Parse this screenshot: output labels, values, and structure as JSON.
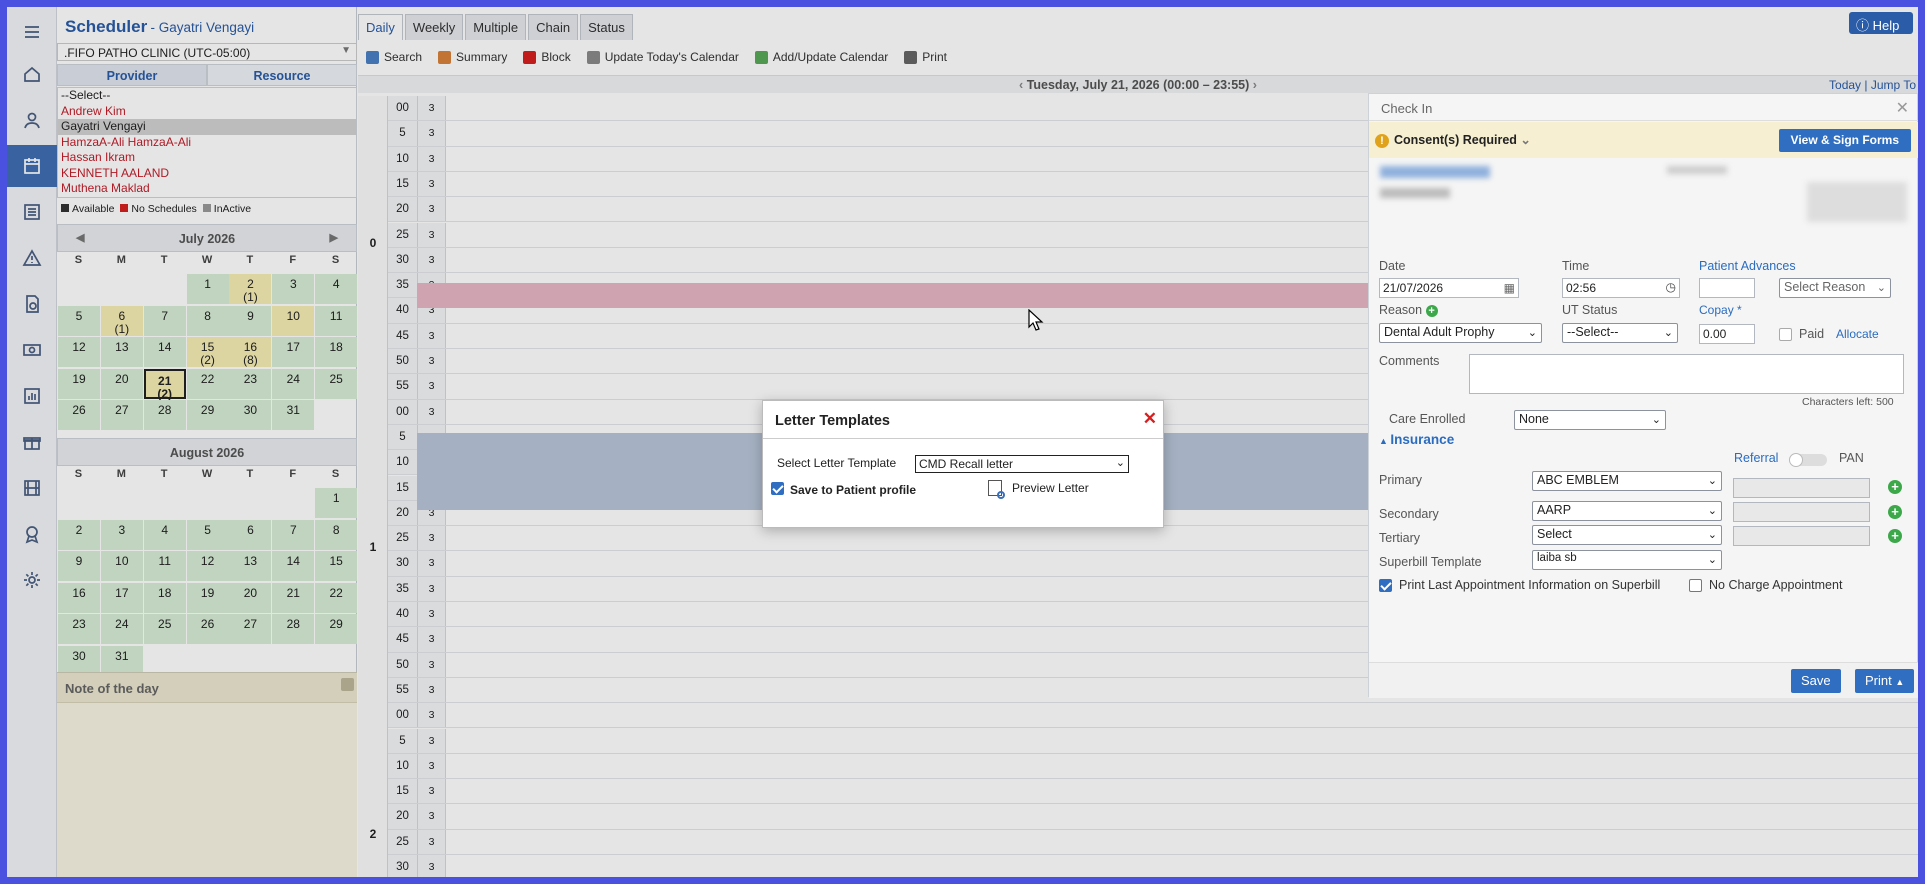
{
  "app": {
    "title": "Scheduler",
    "user": "- Gayatri Vengayi",
    "help": "Help"
  },
  "clinic": ".FIFO PATHO CLINIC (UTC-05:00)",
  "left_tabs": [
    "Provider",
    "Resource"
  ],
  "providers": [
    {
      "name": "--Select--",
      "style": "plain"
    },
    {
      "name": "Andrew Kim",
      "style": "red"
    },
    {
      "name": "Gayatri Vengayi",
      "style": "sel"
    },
    {
      "name": "HamzaA-Ali HamzaA-Ali",
      "style": "red"
    },
    {
      "name": "Hassan Ikram",
      "style": "red"
    },
    {
      "name": "KENNETH AALAND",
      "style": "red"
    },
    {
      "name": "Muthena Maklad",
      "style": "red"
    }
  ],
  "legend": [
    {
      "label": "Available",
      "color": "#333333"
    },
    {
      "label": "No Schedules",
      "color": "#d62020"
    },
    {
      "label": "InActive",
      "color": "#999999"
    }
  ],
  "weekdays": [
    "S",
    "M",
    "T",
    "W",
    "T",
    "F",
    "S"
  ],
  "july": {
    "title": "July 2026",
    "days": [
      {
        "d": "1",
        "s": "",
        "c": "g",
        "col": 3,
        "row": 0
      },
      {
        "d": "2",
        "s": "(1)",
        "c": "y",
        "col": 4,
        "row": 0
      },
      {
        "d": "3",
        "s": "",
        "c": "g",
        "col": 5,
        "row": 0
      },
      {
        "d": "4",
        "s": "",
        "c": "g",
        "col": 6,
        "row": 0
      },
      {
        "d": "5",
        "s": "",
        "c": "g",
        "col": 0,
        "row": 1
      },
      {
        "d": "6",
        "s": "(1)",
        "c": "y",
        "col": 1,
        "row": 1
      },
      {
        "d": "7",
        "s": "",
        "c": "g",
        "col": 2,
        "row": 1
      },
      {
        "d": "8",
        "s": "",
        "c": "g",
        "col": 3,
        "row": 1
      },
      {
        "d": "9",
        "s": "",
        "c": "g",
        "col": 4,
        "row": 1
      },
      {
        "d": "10",
        "s": "",
        "c": "y",
        "col": 5,
        "row": 1
      },
      {
        "d": "11",
        "s": "",
        "c": "g",
        "col": 6,
        "row": 1
      },
      {
        "d": "12",
        "s": "",
        "c": "g",
        "col": 0,
        "row": 2
      },
      {
        "d": "13",
        "s": "",
        "c": "g",
        "col": 1,
        "row": 2
      },
      {
        "d": "14",
        "s": "",
        "c": "g",
        "col": 2,
        "row": 2
      },
      {
        "d": "15",
        "s": "(2)",
        "c": "y",
        "col": 3,
        "row": 2
      },
      {
        "d": "16",
        "s": "(8)",
        "c": "y",
        "col": 4,
        "row": 2
      },
      {
        "d": "17",
        "s": "",
        "c": "g",
        "col": 5,
        "row": 2
      },
      {
        "d": "18",
        "s": "",
        "c": "g",
        "col": 6,
        "row": 2
      },
      {
        "d": "19",
        "s": "",
        "c": "g",
        "col": 0,
        "row": 3
      },
      {
        "d": "20",
        "s": "",
        "c": "g",
        "col": 1,
        "row": 3
      },
      {
        "d": "21",
        "s": "(2)",
        "c": "today",
        "col": 2,
        "row": 3
      },
      {
        "d": "22",
        "s": "",
        "c": "g",
        "col": 3,
        "row": 3
      },
      {
        "d": "23",
        "s": "",
        "c": "g",
        "col": 4,
        "row": 3
      },
      {
        "d": "24",
        "s": "",
        "c": "g",
        "col": 5,
        "row": 3
      },
      {
        "d": "25",
        "s": "",
        "c": "g",
        "col": 6,
        "row": 3
      },
      {
        "d": "26",
        "s": "",
        "c": "g",
        "col": 0,
        "row": 4
      },
      {
        "d": "27",
        "s": "",
        "c": "g",
        "col": 1,
        "row": 4
      },
      {
        "d": "28",
        "s": "",
        "c": "g",
        "col": 2,
        "row": 4
      },
      {
        "d": "29",
        "s": "",
        "c": "g",
        "col": 3,
        "row": 4
      },
      {
        "d": "30",
        "s": "",
        "c": "g",
        "col": 4,
        "row": 4
      },
      {
        "d": "31",
        "s": "",
        "c": "g",
        "col": 5,
        "row": 4
      }
    ]
  },
  "august": {
    "title": "August 2026",
    "days": [
      {
        "d": "1",
        "s": "",
        "c": "g",
        "col": 6,
        "row": 0
      },
      {
        "d": "2",
        "s": "",
        "c": "g",
        "col": 0,
        "row": 1
      },
      {
        "d": "3",
        "s": "",
        "c": "g",
        "col": 1,
        "row": 1
      },
      {
        "d": "4",
        "s": "",
        "c": "g",
        "col": 2,
        "row": 1
      },
      {
        "d": "5",
        "s": "",
        "c": "g",
        "col": 3,
        "row": 1
      },
      {
        "d": "6",
        "s": "",
        "c": "g",
        "col": 4,
        "row": 1
      },
      {
        "d": "7",
        "s": "",
        "c": "g",
        "col": 5,
        "row": 1
      },
      {
        "d": "8",
        "s": "",
        "c": "g",
        "col": 6,
        "row": 1
      },
      {
        "d": "9",
        "s": "",
        "c": "g",
        "col": 0,
        "row": 2
      },
      {
        "d": "10",
        "s": "",
        "c": "g",
        "col": 1,
        "row": 2
      },
      {
        "d": "11",
        "s": "",
        "c": "g",
        "col": 2,
        "row": 2
      },
      {
        "d": "12",
        "s": "",
        "c": "g",
        "col": 3,
        "row": 2
      },
      {
        "d": "13",
        "s": "",
        "c": "g",
        "col": 4,
        "row": 2
      },
      {
        "d": "14",
        "s": "",
        "c": "g",
        "col": 5,
        "row": 2
      },
      {
        "d": "15",
        "s": "",
        "c": "g",
        "col": 6,
        "row": 2
      },
      {
        "d": "16",
        "s": "",
        "c": "g",
        "col": 0,
        "row": 3
      },
      {
        "d": "17",
        "s": "",
        "c": "g",
        "col": 1,
        "row": 3
      },
      {
        "d": "18",
        "s": "",
        "c": "g",
        "col": 2,
        "row": 3
      },
      {
        "d": "19",
        "s": "",
        "c": "g",
        "col": 3,
        "row": 3
      },
      {
        "d": "20",
        "s": "",
        "c": "g",
        "col": 4,
        "row": 3
      },
      {
        "d": "21",
        "s": "",
        "c": "g",
        "col": 5,
        "row": 3
      },
      {
        "d": "22",
        "s": "",
        "c": "g",
        "col": 6,
        "row": 3
      },
      {
        "d": "23",
        "s": "",
        "c": "g",
        "col": 0,
        "row": 4
      },
      {
        "d": "24",
        "s": "",
        "c": "g",
        "col": 1,
        "row": 4
      },
      {
        "d": "25",
        "s": "",
        "c": "g",
        "col": 2,
        "row": 4
      },
      {
        "d": "26",
        "s": "",
        "c": "g",
        "col": 3,
        "row": 4
      },
      {
        "d": "27",
        "s": "",
        "c": "g",
        "col": 4,
        "row": 4
      },
      {
        "d": "28",
        "s": "",
        "c": "g",
        "col": 5,
        "row": 4
      },
      {
        "d": "29",
        "s": "",
        "c": "g",
        "col": 6,
        "row": 4
      },
      {
        "d": "30",
        "s": "",
        "c": "g",
        "col": 0,
        "row": 5
      },
      {
        "d": "31",
        "s": "",
        "c": "g",
        "col": 1,
        "row": 5
      }
    ]
  },
  "note": {
    "title": "Note of the day"
  },
  "view_tabs": [
    "Daily",
    "Weekly",
    "Multiple",
    "Chain",
    "Status"
  ],
  "toolbar": [
    {
      "label": "Search",
      "icon": "search-icon",
      "color": "#4a7fc4"
    },
    {
      "label": "Summary",
      "icon": "summary-icon",
      "color": "#d9823a"
    },
    {
      "label": "Block",
      "icon": "block-icon",
      "color": "#d62020"
    },
    {
      "label": "Update Today's Calendar",
      "icon": "calendar-update-icon",
      "color": "#8a8a8a"
    },
    {
      "label": "Add/Update Calendar",
      "icon": "calendar-add-icon",
      "color": "#58a858"
    },
    {
      "label": "Print",
      "icon": "print-icon",
      "color": "#666666"
    }
  ],
  "datebar": {
    "date": "Tuesday, July 21, 2026 (00:00 – 23:55)",
    "today": "Today",
    "jump": "Jump To"
  },
  "hours": [
    "0",
    "1",
    "2"
  ],
  "slots": [
    {
      "m": "00",
      "c": "3"
    },
    {
      "m": "5",
      "c": "3"
    },
    {
      "m": "10",
      "c": "3"
    },
    {
      "m": "15",
      "c": "3"
    },
    {
      "m": "20",
      "c": "3"
    },
    {
      "m": "25",
      "c": "3"
    },
    {
      "m": "30",
      "c": "3"
    },
    {
      "m": "35",
      "c": "2"
    },
    {
      "m": "40",
      "c": "3"
    },
    {
      "m": "45",
      "c": "3"
    },
    {
      "m": "50",
      "c": "3"
    },
    {
      "m": "55",
      "c": "3"
    },
    {
      "m": "00",
      "c": "3"
    },
    {
      "m": "5",
      "c": "2"
    },
    {
      "m": "10",
      "c": "2"
    },
    {
      "m": "15",
      "c": "2"
    },
    {
      "m": "20",
      "c": "3"
    },
    {
      "m": "25",
      "c": "3"
    },
    {
      "m": "30",
      "c": "3"
    },
    {
      "m": "35",
      "c": "3"
    },
    {
      "m": "40",
      "c": "3"
    },
    {
      "m": "45",
      "c": "3"
    },
    {
      "m": "50",
      "c": "3"
    },
    {
      "m": "55",
      "c": "3"
    },
    {
      "m": "00",
      "c": "3"
    },
    {
      "m": "5",
      "c": "3"
    },
    {
      "m": "10",
      "c": "3"
    },
    {
      "m": "15",
      "c": "3"
    },
    {
      "m": "20",
      "c": "3"
    },
    {
      "m": "25",
      "c": "3"
    },
    {
      "m": "30",
      "c": "3"
    }
  ],
  "checkin": {
    "title": "Check In",
    "consent": "Consent(s) Required",
    "view_sign": "View & Sign Forms",
    "date_label": "Date",
    "date": "21/07/2026",
    "time_label": "Time",
    "time": "02:56",
    "advances_label": "Patient Advances",
    "select_reason": "Select Reason",
    "reason_label": "Reason",
    "reason": "Dental Adult Prophy",
    "ut_label": "UT Status",
    "ut": "--Select--",
    "copay_label": "Copay *",
    "copay": "0.00",
    "paid": "Paid",
    "allocate": "Allocate",
    "comments_label": "Comments",
    "chars_left": "Characters left: 500",
    "care_label": "Care Enrolled",
    "care": "None",
    "insurance": "Insurance",
    "referral": "Referral",
    "pan": "PAN",
    "primary_label": "Primary",
    "primary": "ABC EMBLEM",
    "secondary_label": "Secondary",
    "secondary": "AARP",
    "tertiary_label": "Tertiary",
    "tertiary": "Select",
    "superbill_label": "Superbill Template",
    "superbill": "laiba sb",
    "print_last": "Print Last Appointment Information on Superbill",
    "no_charge": "No Charge Appointment",
    "save": "Save",
    "print": "Print"
  },
  "modal": {
    "title": "Letter Templates",
    "select_label": "Select Letter Template",
    "template": "CMD Recall letter",
    "save_profile": "Save to Patient profile",
    "preview": "Preview Letter"
  }
}
